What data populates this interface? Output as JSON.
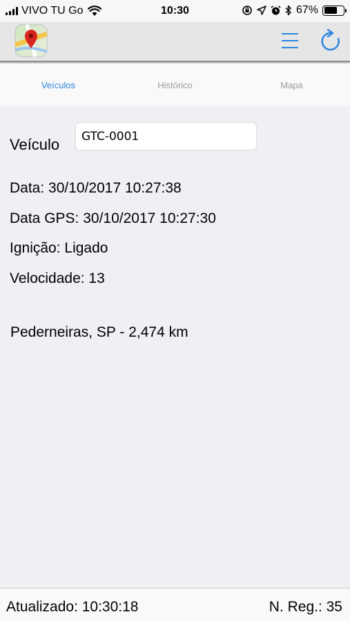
{
  "status_bar": {
    "carrier": "VIVO TU Go",
    "time": "10:30",
    "battery_text": "67%",
    "battery_level": 0.67
  },
  "nav": {
    "logo_icon": "map-pin-icon",
    "menu_icon": "hamburger-menu-icon",
    "refresh_icon": "refresh-icon",
    "accent_color": "#2b84e0"
  },
  "tabs": [
    {
      "label": "Veículos",
      "active": true
    },
    {
      "label": "Histórico",
      "active": false
    },
    {
      "label": "Mapa",
      "active": false
    }
  ],
  "vehicle": {
    "label": "Veículo",
    "value": "GTC-0001"
  },
  "details": {
    "data": "Data: 30/10/2017 10:27:38",
    "data_gps": "Data GPS: 30/10/2017 10:27:30",
    "ignicao": "Ignição: Ligado",
    "velocidade": "Velocidade: 13"
  },
  "location": "Pederneiras, SP - 2,474 km",
  "footer": {
    "updated": "Atualizado: 10:30:18",
    "count": "N. Reg.: 35"
  }
}
